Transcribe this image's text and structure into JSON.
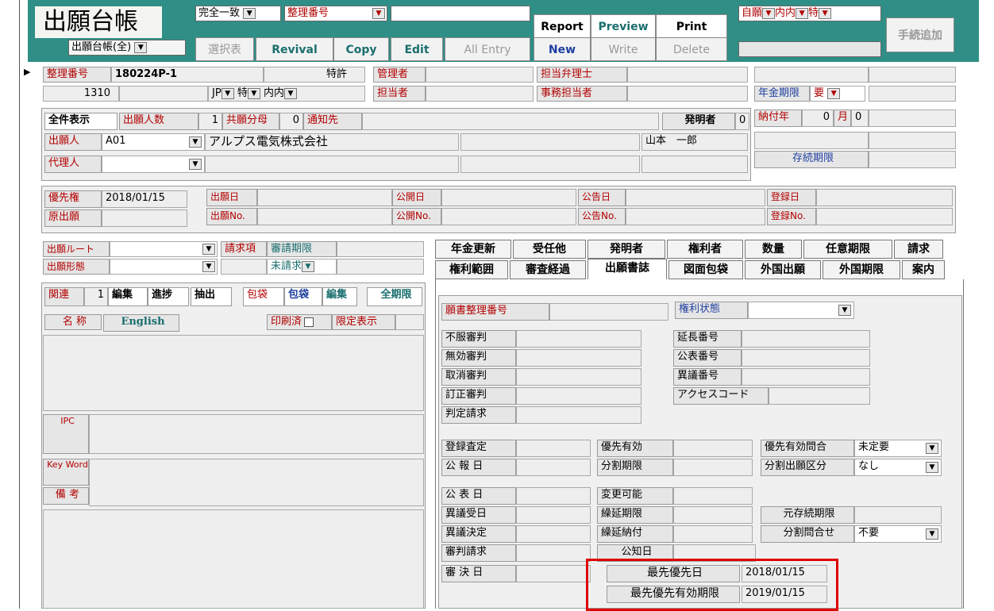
{
  "header": {
    "title": "出願台帳",
    "match_select": "完全一致",
    "field_select": "整理番号",
    "search_value": "",
    "ledger_select": "出願台帳(全)",
    "add_procedure": "手続追加",
    "filter1": "自願",
    "filter2": "内内",
    "filter3": "特"
  },
  "toolbar": {
    "report": "Report",
    "preview": "Preview",
    "print": "Print",
    "select_table": "選択表",
    "revival": "Revival",
    "copy": "Copy",
    "edit": "Edit",
    "all_entry": "All Entry",
    "new": "New",
    "write": "Write",
    "delete": "Delete"
  },
  "record": {
    "seiri_label": "整理番号",
    "seiri_value": "180224P-1",
    "num": "1310",
    "patent_select": "特許",
    "country_select": "JP",
    "type_select": "特",
    "naibu_select": "内内",
    "manager_label": "管理者",
    "tanto_label": "担当者",
    "attorney_label": "担当弁理士",
    "clerk_label": "事務担当者",
    "annuity_label": "年金期限",
    "annuity_value": "要",
    "all_display": "全件表示",
    "applicants_label": "出願人数",
    "applicants_value": "1",
    "joint_label": "共願分母",
    "joint_value": "0",
    "notice_label": "通知先",
    "inventor_label": "発明者",
    "inventor_count": "0",
    "paid_year_label": "納付年",
    "paid_year_value": "0",
    "month_label": "月",
    "month_value": "0",
    "applicant_label": "出願人",
    "applicant_code": "A01",
    "applicant_name": "アルプス電気株式会社",
    "inventor_name": "山本　一郎",
    "agent_label": "代理人",
    "survival_label": "存続期限",
    "priority_label": "優先権",
    "priority_value": "2018/01/15",
    "original_label": "原出願",
    "app_date_label": "出願日",
    "app_no_label": "出願No.",
    "pub_date_label": "公開日",
    "pub_no_label": "公開No.",
    "ann_date_label": "公告日",
    "ann_no_label": "公告No.",
    "reg_date_label": "登録日",
    "reg_no_label": "登録No."
  },
  "left": {
    "route_label": "出願ルート",
    "form_label": "出願形態",
    "claim_label": "請求項",
    "exam_label": "審請期限",
    "unclaimed": "未請求",
    "related": "関連",
    "related_count": "1",
    "edit": "編集",
    "progress": "進捗",
    "extract": "抽出",
    "wrap": "包袋",
    "wrap2": "包袋",
    "edit2": "編集",
    "all_period": "全期限",
    "name_label": "名 称",
    "english": "English",
    "printed": "印刷済",
    "limited": "限定表示",
    "ipc": "IPC",
    "keyword": "Key Word",
    "remarks": "備 考"
  },
  "tabs_row1": [
    "年金更新",
    "受任他",
    "発明者",
    "権利者",
    "数量",
    "任意期限",
    "請求"
  ],
  "tabs_row2": [
    "権利範囲",
    "審査経過",
    "出願書誌",
    "図面包袋",
    "外国出願",
    "外国期限",
    "案内"
  ],
  "form": {
    "doc_no": "願書整理番号",
    "right_status": "権利状態",
    "appeal1": "不服審判",
    "appeal2": "無効審判",
    "appeal3": "取消審判",
    "appeal4": "訂正審判",
    "judgment": "判定請求",
    "ext_no": "延長番号",
    "pubnum": "公表番号",
    "opp_no": "異議番号",
    "access": "アクセスコード",
    "reg_assess": "登録査定",
    "bulletin": "公 報 日",
    "pub_date": "公 表 日",
    "opp_recv": "異議受日",
    "opp_dec": "異議決定",
    "trial_req": "審判請求",
    "trial_dec": "審 決 日",
    "prio_valid": "優先有効",
    "div_deadline": "分割期限",
    "changeable": "変更可能",
    "defer_deadline": "繰延期限",
    "defer_pay": "繰延納付",
    "notice_date": "公知日",
    "prio_inquiry": "優先有効問合",
    "prio_inquiry_val": "未定要",
    "div_class": "分割出願区分",
    "div_class_val": "なし",
    "orig_survival": "元存続期限",
    "div_inquiry": "分割問合せ",
    "div_inquiry_val": "不要",
    "earliest_prio": "最先優先日",
    "earliest_prio_val": "2018/01/15",
    "earliest_valid": "最先優先有効期限",
    "earliest_valid_val": "2019/01/15"
  }
}
